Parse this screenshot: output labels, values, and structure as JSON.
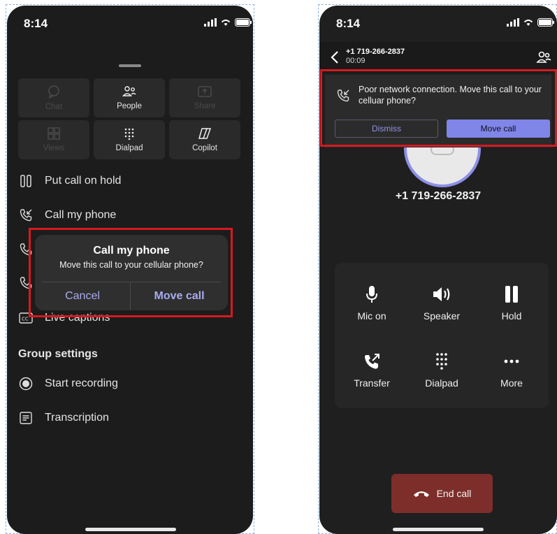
{
  "left_phone": {
    "status_time": "8:14",
    "grid": [
      {
        "label": "Chat",
        "icon": "chat-icon",
        "enabled": false
      },
      {
        "label": "People",
        "icon": "people-icon",
        "enabled": true
      },
      {
        "label": "Share",
        "icon": "share-icon",
        "enabled": false
      },
      {
        "label": "Views",
        "icon": "views-icon",
        "enabled": false
      },
      {
        "label": "Dialpad",
        "icon": "dialpad-icon",
        "enabled": true
      },
      {
        "label": "Copilot",
        "icon": "copilot-icon",
        "enabled": true
      }
    ],
    "menu": {
      "hold": "Put call on hold",
      "call_my_phone": "Call my phone",
      "live_captions": "Live captions"
    },
    "group_settings": {
      "heading": "Group settings",
      "start_recording": "Start recording",
      "transcription": "Transcription"
    },
    "dialog": {
      "title": "Call my phone",
      "message": "Move this call to your cellular phone?",
      "cancel": "Cancel",
      "confirm": "Move call"
    }
  },
  "right_phone": {
    "status_time": "8:14",
    "header": {
      "number": "+1 719-266-2837",
      "duration": "00:09"
    },
    "banner": {
      "message": "Poor network connection. Move this call to your celluar phone?",
      "dismiss": "Dismiss",
      "move": "Move call"
    },
    "caller_number": "+1 719-266-2837",
    "controls": [
      {
        "label": "Mic on",
        "icon": "mic-icon"
      },
      {
        "label": "Speaker",
        "icon": "speaker-icon"
      },
      {
        "label": "Hold",
        "icon": "pause-icon"
      },
      {
        "label": "Transfer",
        "icon": "transfer-icon"
      },
      {
        "label": "Dialpad",
        "icon": "dialpad-icon"
      },
      {
        "label": "More",
        "icon": "more-icon"
      }
    ],
    "end_call": "End call"
  },
  "colors": {
    "accent": "#8085e8",
    "highlight": "#d71920",
    "end_call": "#7d2e2a",
    "dialog_text": "#a9acf0"
  }
}
